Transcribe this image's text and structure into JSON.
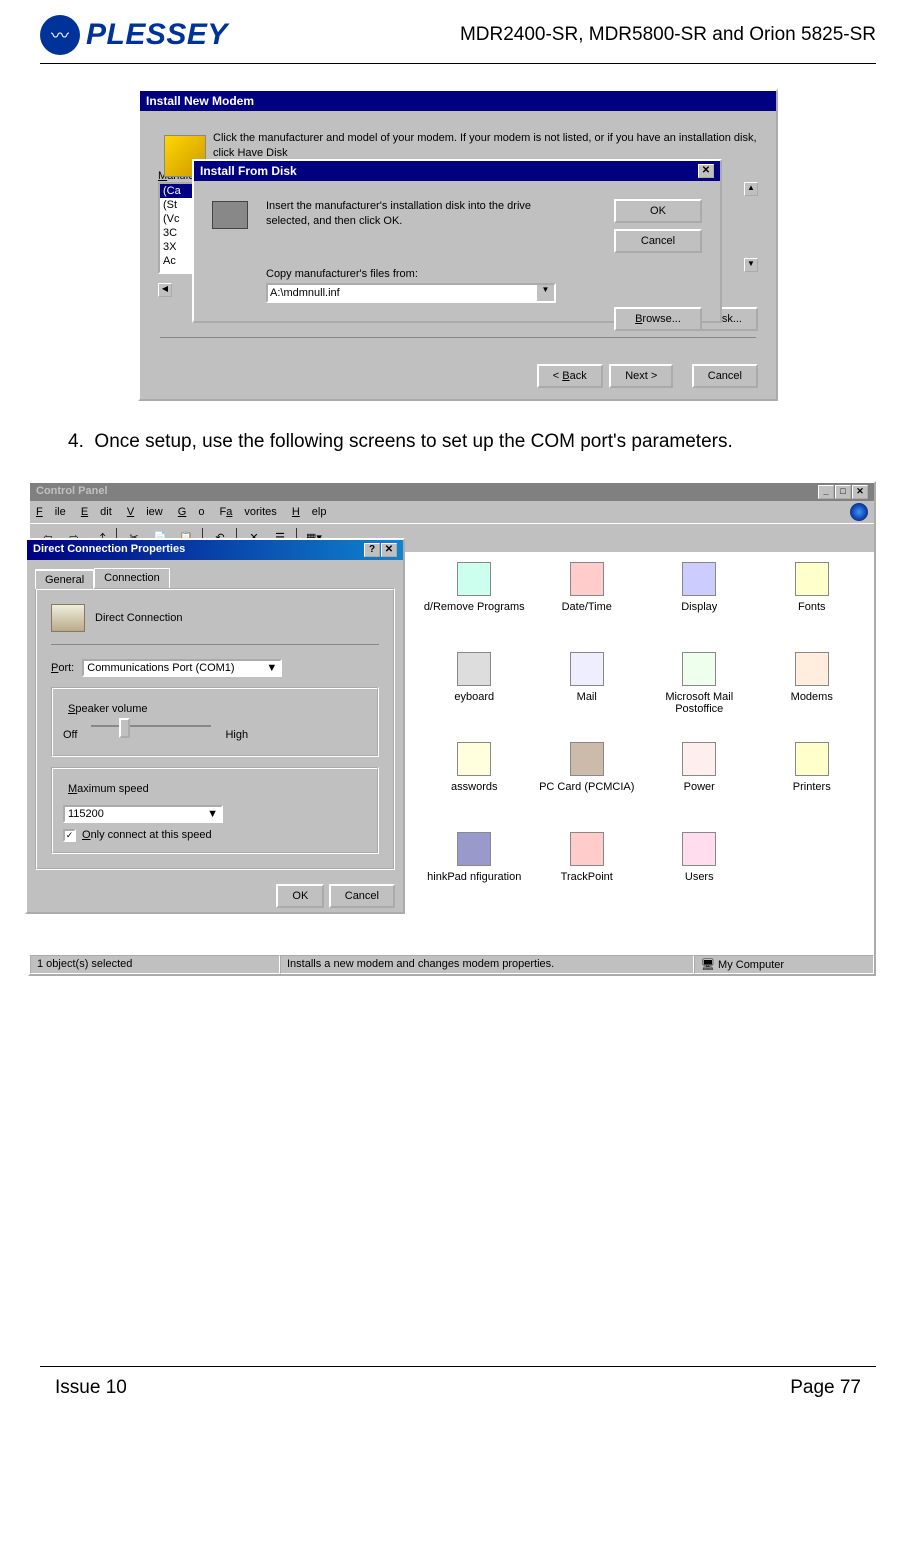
{
  "header": {
    "logo_text": "PLESSEY",
    "doc_title": "MDR2400-SR, MDR5800-SR and Orion 5825-SR"
  },
  "install_modem": {
    "title": "Install New Modem",
    "instruction": "Click the manufacturer and model of your modem. If your modem is not listed, or if you have an installation disk, click Have Disk",
    "mfr_label": "Manufacturers:",
    "mfr_items": [
      "(Ca",
      "(St",
      "(Vc",
      "3C",
      "3X",
      "Ac"
    ],
    "have_disk": "Have Disk...",
    "back": "< Back",
    "next": "Next >",
    "cancel": "Cancel"
  },
  "install_from_disk": {
    "title": "Install From Disk",
    "instruction": "Insert the manufacturer's installation disk into the drive selected, and then click OK.",
    "ok": "OK",
    "cancel": "Cancel",
    "browse": "Browse...",
    "copy_label": "Copy manufacturer's files from:",
    "path": "A:\\mdmnull.inf"
  },
  "step": {
    "num": "4.",
    "text": "Once setup, use the following screens to set up the COM port's parameters."
  },
  "control_panel": {
    "title": "Control Panel",
    "menus": [
      "File",
      "Edit",
      "View",
      "Go",
      "Favorites",
      "Help"
    ],
    "icons": [
      {
        "label": "d/Remove Programs"
      },
      {
        "label": "Date/Time"
      },
      {
        "label": "Display"
      },
      {
        "label": "Fonts"
      },
      {
        "label": "eyboard"
      },
      {
        "label": "Mail"
      },
      {
        "label": "Microsoft Mail Postoffice"
      },
      {
        "label": "Modems"
      },
      {
        "label": "asswords"
      },
      {
        "label": "PC Card (PCMCIA)"
      },
      {
        "label": "Power"
      },
      {
        "label": "Printers"
      },
      {
        "label": "hinkPad nfiguration"
      },
      {
        "label": "TrackPoint"
      },
      {
        "label": "Users"
      }
    ],
    "status_left": "1 object(s) selected",
    "status_mid": "Installs a new modem and changes modem properties.",
    "status_right": "My Computer"
  },
  "dcp": {
    "title": "Direct Connection Properties",
    "tab_general": "General",
    "tab_connection": "Connection",
    "name": "Direct Connection",
    "port_label": "Port:",
    "port_value": "Communications Port (COM1)",
    "speaker_label": "Speaker volume",
    "off": "Off",
    "high": "High",
    "max_speed_label": "Maximum speed",
    "max_speed_value": "115200",
    "only_connect": "Only connect at this speed",
    "ok": "OK",
    "cancel": "Cancel"
  },
  "footer": {
    "issue": "Issue 10",
    "page": "Page 77"
  }
}
